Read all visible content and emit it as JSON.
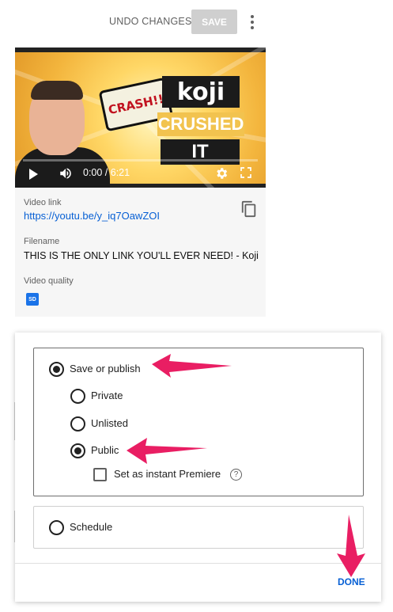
{
  "topbar": {
    "undo_label": "UNDO CHANGES",
    "save_label": "SAVE",
    "more_icon": "more-vert-icon"
  },
  "video": {
    "thumb_text_crash": "CRASH!!",
    "thumb_text_brand": "koji",
    "thumb_text_crushed": "CRUSHED",
    "thumb_text_it": "IT",
    "time": "0:00 / 6:21",
    "link_label": "Video link",
    "link": "https://youtu.be/y_iq7OawZOI",
    "filename_label": "Filename",
    "filename": "THIS IS THE ONLY LINK YOU'LL EVER NEED! - Koji",
    "quality_label": "Video quality",
    "quality_badge": "SD"
  },
  "visibility": {
    "save_publish_label": "Save or publish",
    "options": [
      {
        "label": "Private",
        "selected": false
      },
      {
        "label": "Unlisted",
        "selected": false
      },
      {
        "label": "Public",
        "selected": true
      }
    ],
    "premiere_label": "Set as instant Premiere",
    "schedule_label": "Schedule",
    "done_label": "DONE"
  },
  "colors": {
    "accent": "#065fd4",
    "arrow": "#e91e63"
  }
}
